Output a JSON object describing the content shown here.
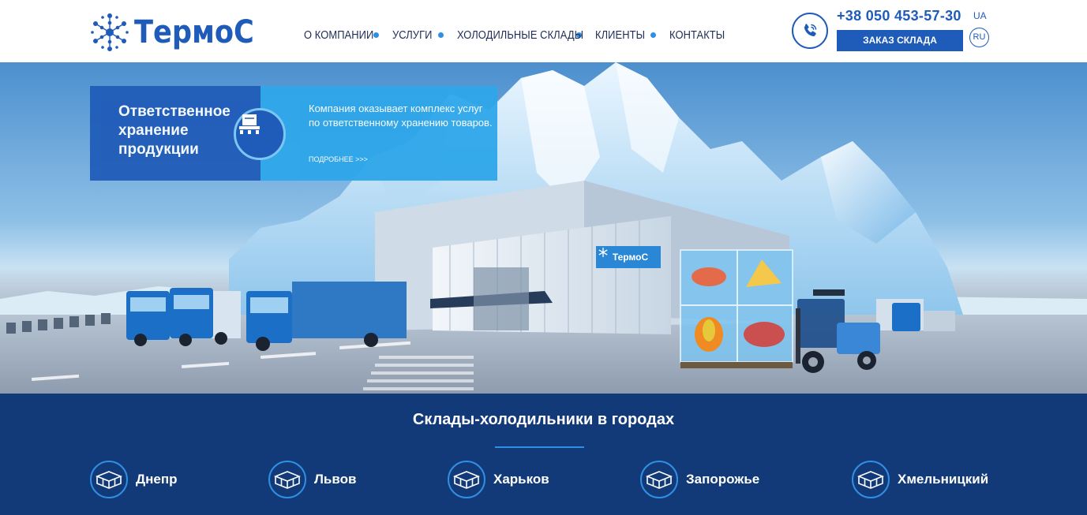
{
  "header": {
    "logo_text": "ТермоС",
    "nav": [
      "О КОМПАНИИ",
      "УСЛУГИ",
      "ХОЛОДИЛЬНЫЕ СКЛАДЫ",
      "КЛИЕНТЫ",
      "КОНТАКТЫ"
    ],
    "phone": "+38 050 453-57-30",
    "lang_ua": "UA",
    "lang_ru": "RU",
    "order_button": "ЗАКАЗ СКЛАДА"
  },
  "hero": {
    "card_title": "Ответственное хранение продукции",
    "card_text": "Компания оказывает комплекс услуг по ответственному хранению товаров.",
    "card_link": "ПОДРОБНЕЕ >>>",
    "building_sign": "ТермоС"
  },
  "cities": {
    "title": "Склады-холодильники в городах",
    "items": [
      "Днепр",
      "Львов",
      "Харьков",
      "Запорожье",
      "Хмельницкий"
    ]
  },
  "colors": {
    "brand_blue": "#1f5bb8",
    "accent_blue": "#2ea7ea",
    "dark_navy": "#123a78"
  }
}
